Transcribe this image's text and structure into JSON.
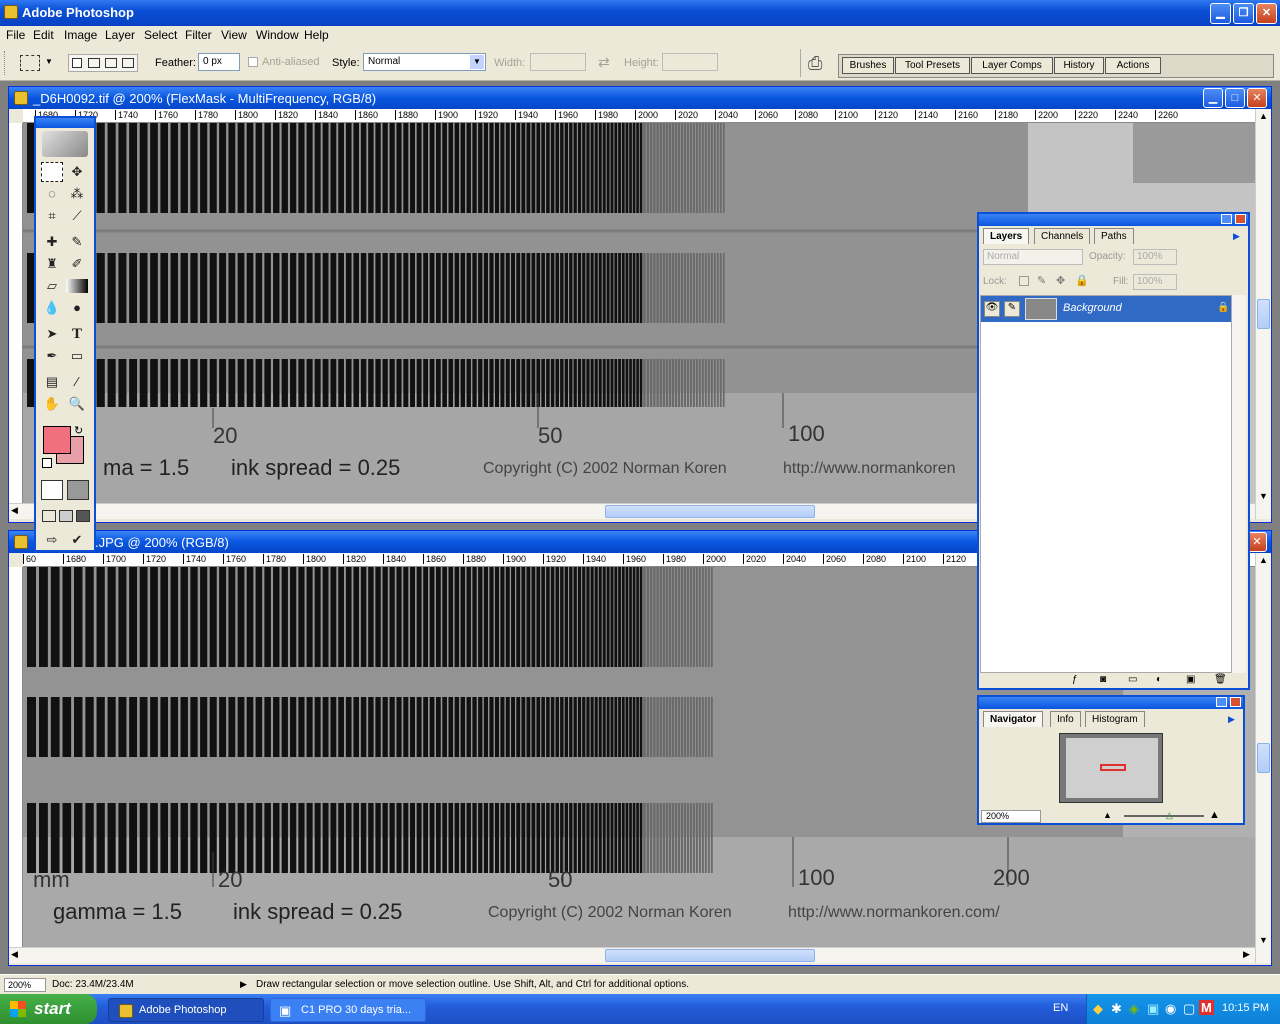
{
  "app": {
    "title": "Adobe Photoshop"
  },
  "menu": [
    "File",
    "Edit",
    "Image",
    "Layer",
    "Select",
    "Filter",
    "View",
    "Window",
    "Help"
  ],
  "options": {
    "feather_label": "Feather:",
    "feather_value": "0 px",
    "antialias_label": "Anti-aliased",
    "style_label": "Style:",
    "style_value": "Normal",
    "width_label": "Width:",
    "height_label": "Height:"
  },
  "palette_well": [
    "Brushes",
    "Tool Presets",
    "Layer Comps",
    "History",
    "Actions"
  ],
  "doc1": {
    "title": "_D6H0092.tif @ 200% (FlexMask - MultiFrequency, RGB/8)",
    "ruler": [
      "1680",
      "1720",
      "1740",
      "1760",
      "1780",
      "1800",
      "1820",
      "1840",
      "1860",
      "1880",
      "1900",
      "1920",
      "1940",
      "1960",
      "1980",
      "2000",
      "2020",
      "2040",
      "2060",
      "2080",
      "2100",
      "2120",
      "2140",
      "2160",
      "2180",
      "2200",
      "2220",
      "2240",
      "2260"
    ],
    "chart_labels": {
      "n20": "20",
      "n50": "50",
      "n100": "100",
      "gamma": "ma = 1.5",
      "ink": "ink spread = 0.25",
      "copyright": "Copyright (C) 2002 Norman Koren",
      "url": "http://www.normankoren"
    }
  },
  "doc2": {
    "title": ".JPG @ 200% (RGB/8)",
    "ruler": [
      "60",
      "1680",
      "1700",
      "1720",
      "1740",
      "1760",
      "1780",
      "1800",
      "1820",
      "1840",
      "1860",
      "1880",
      "1900",
      "1920",
      "1940",
      "1960",
      "1980",
      "2000",
      "2020",
      "2040",
      "2060",
      "2080",
      "2100",
      "2120"
    ],
    "chart_labels": {
      "mm": "mm",
      "n20": "20",
      "n50": "50",
      "n100": "100",
      "n200": "200",
      "gamma": "gamma = 1.5",
      "ink": "ink spread = 0.25",
      "copyright": "Copyright (C) 2002 Norman Koren",
      "url": "http://www.normankoren.com/"
    }
  },
  "layers_palette": {
    "tabs": [
      "Layers",
      "Channels",
      "Paths"
    ],
    "blend_mode": "Normal",
    "opacity_label": "Opacity:",
    "opacity_value": "100%",
    "lock_label": "Lock:",
    "fill_label": "Fill:",
    "fill_value": "100%",
    "layer_name": "Background"
  },
  "navigator_palette": {
    "tabs": [
      "Navigator",
      "Info",
      "Histogram"
    ],
    "zoom": "200%"
  },
  "status": {
    "zoom": "200%",
    "doc": "Doc: 23.4M/23.4M",
    "hint": "Draw rectangular selection or move selection outline.  Use Shift, Alt, and Ctrl for additional options."
  },
  "taskbar": {
    "start": "start",
    "items": [
      "Adobe Photoshop",
      "C1 PRO 30 days tria..."
    ],
    "lang": "EN",
    "time": "10:15 PM"
  },
  "colors": {
    "foreground": "#f07080",
    "background": "#e8a0a8",
    "xp_blue": "#0a4fd6"
  }
}
